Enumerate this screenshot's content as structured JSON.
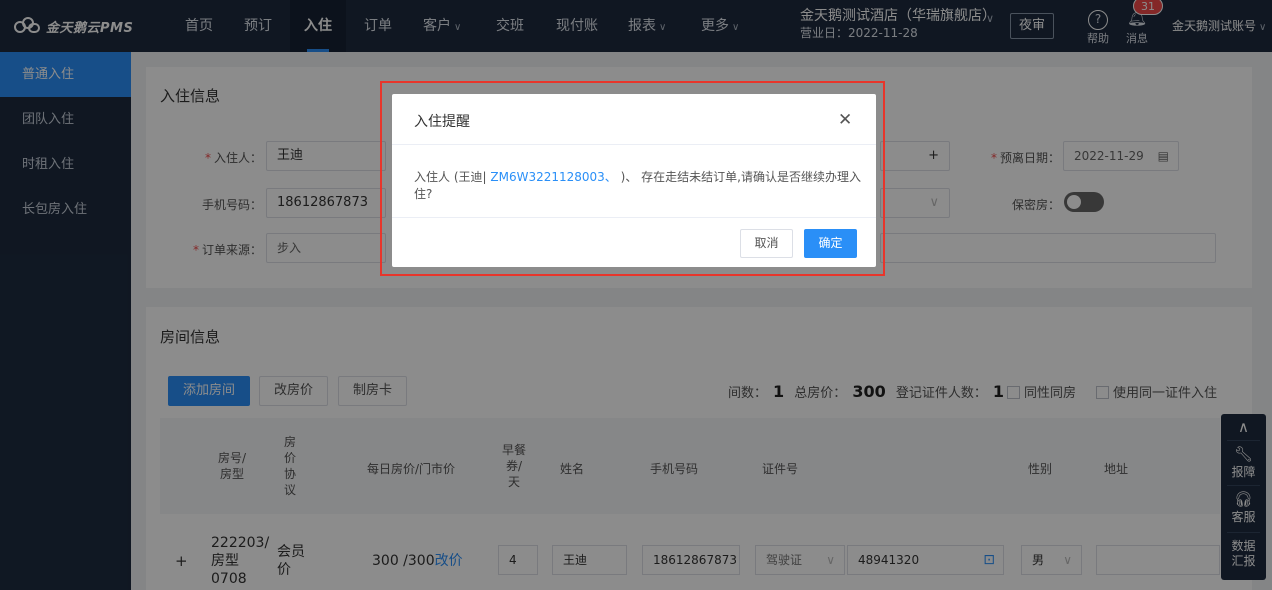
{
  "app": {
    "logo_text": "金天鹅云PMS"
  },
  "nav": {
    "items": [
      {
        "label": "首页"
      },
      {
        "label": "预订"
      },
      {
        "label": "入住"
      },
      {
        "label": "订单"
      },
      {
        "label": "客户"
      },
      {
        "label": "交班"
      },
      {
        "label": "现付账"
      },
      {
        "label": "报表"
      },
      {
        "label": "更多"
      }
    ],
    "active": "入住"
  },
  "header": {
    "hotel_name": "金天鹅测试酒店（华瑞旗舰店）",
    "business_date": "营业日：2022-11-28",
    "night_audit": "夜审",
    "help": "帮助",
    "messages": "消息",
    "message_count": "31",
    "account": "金天鹅测试账号"
  },
  "sidebar": {
    "items": [
      {
        "label": "普通入住"
      },
      {
        "label": "团队入住"
      },
      {
        "label": "时租入住"
      },
      {
        "label": "长包房入住"
      }
    ]
  },
  "checkin_info": {
    "title": "入住信息",
    "guest_label": "入住人：",
    "guest_value": "王迪",
    "phone_label": "手机号码：",
    "phone_value": "18612867873",
    "source_label": "订单来源：",
    "source_value": "步入",
    "add_symbol": "+",
    "departure_label": "预离日期：",
    "departure_value": "2022-11-29",
    "secret_room_label": "保密房："
  },
  "room_info": {
    "title": "房间信息",
    "add_room": "添加房间",
    "change_price": "改房价",
    "make_card": "制房卡",
    "count_label": "间数：",
    "count_value": "1",
    "total_label": "总房价：",
    "total_value": "300",
    "registered_label": "登记证件人数：",
    "registered_value": "1",
    "same_gender": "同性同房",
    "same_id": "使用同一证件入住",
    "columns": {
      "room": "房号/\n房型",
      "agreement": "房\n价\n协\n议",
      "daily_price": "每日房价/门市价",
      "breakfast": "早餐\n券/\n天",
      "name": "姓名",
      "phone": "手机号码",
      "id_no": "证件号",
      "gender": "性别",
      "address": "地址"
    },
    "row": {
      "expand": "+",
      "room": "222203/\n房型\n0708",
      "agreement": "会员\n价",
      "price": "300 /300",
      "change_link": "改价",
      "breakfast": "4",
      "name": "王迪",
      "phone": "18612867873",
      "id_type": "驾驶证",
      "id_no": "48941320",
      "gender": "男"
    }
  },
  "modal": {
    "title": "入住提醒",
    "body_prefix": "入住人 (王迪|",
    "order_no": "ZM6W3221128003、",
    "body_suffix": ")、 存在走结未结订单,请确认是否继续办理入住?",
    "cancel": "取消",
    "confirm": "确定"
  },
  "float_bar": {
    "report": "报障",
    "service": "客服",
    "data_report": "数据\n汇报"
  },
  "colors": {
    "primary": "#2a8ff7",
    "nav_bg": "#1e2b3f",
    "highlight": "#e8352b"
  }
}
